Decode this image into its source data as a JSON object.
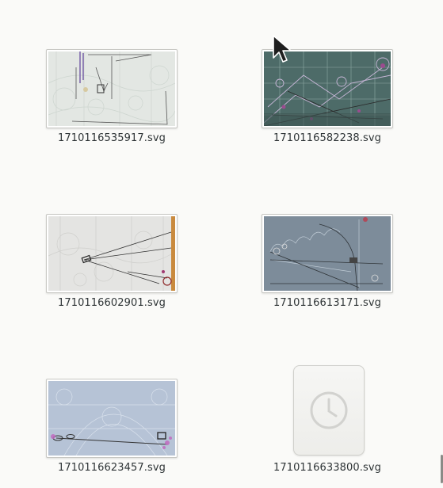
{
  "files": [
    {
      "name": "1710116535917.svg",
      "kind": "thumbnail",
      "icon": "svg-thumbnail"
    },
    {
      "name": "1710116582238.svg",
      "kind": "thumbnail",
      "icon": "svg-thumbnail"
    },
    {
      "name": "1710116602901.svg",
      "kind": "thumbnail",
      "icon": "svg-thumbnail"
    },
    {
      "name": "1710116613171.svg",
      "kind": "thumbnail",
      "icon": "svg-thumbnail"
    },
    {
      "name": "1710116623457.svg",
      "kind": "thumbnail",
      "icon": "svg-thumbnail"
    },
    {
      "name": "1710116633800.svg",
      "kind": "loading",
      "icon": "clock-icon"
    }
  ],
  "colors": {
    "background": "#fafaf8",
    "label": "#2e3436",
    "thumb_border": "#c8c8c4"
  }
}
